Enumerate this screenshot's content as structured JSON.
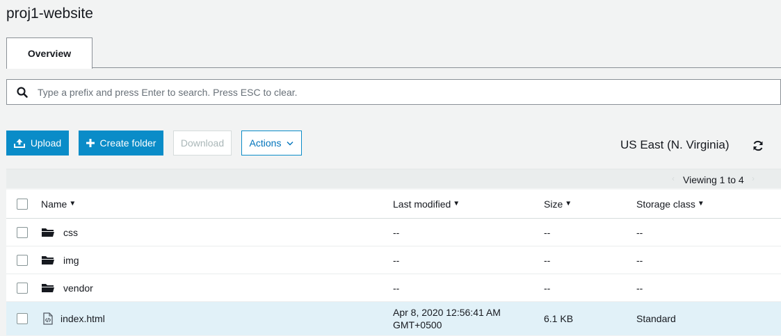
{
  "page": {
    "title": "proj1-website"
  },
  "tabs": [
    {
      "label": "Overview",
      "active": true
    }
  ],
  "search": {
    "placeholder": "Type a prefix and press Enter to search. Press ESC to clear.",
    "value": ""
  },
  "toolbar": {
    "upload_label": "Upload",
    "create_folder_label": "Create folder",
    "download_label": "Download",
    "actions_label": "Actions",
    "region": "US East (N. Virginia)"
  },
  "paging": {
    "label": "Viewing 1 to 4"
  },
  "table": {
    "columns": {
      "name": "Name",
      "last_modified": "Last modified",
      "size": "Size",
      "storage_class": "Storage class"
    },
    "rows": [
      {
        "type": "folder",
        "name": "css",
        "last_modified": "--",
        "last_modified_2": "",
        "size": "--",
        "storage_class": "--"
      },
      {
        "type": "folder",
        "name": "img",
        "last_modified": "--",
        "last_modified_2": "",
        "size": "--",
        "storage_class": "--"
      },
      {
        "type": "folder",
        "name": "vendor",
        "last_modified": "--",
        "last_modified_2": "",
        "size": "--",
        "storage_class": "--"
      },
      {
        "type": "file",
        "name": "index.html",
        "last_modified": "Apr 8, 2020 12:56:41 AM",
        "last_modified_2": "GMT+0500",
        "size": "6.1 KB",
        "storage_class": "Standard"
      }
    ]
  },
  "colors": {
    "primary": "#0a8cc8",
    "selected_row": "#e1f1f8",
    "background": "#f2f3f3"
  },
  "icons": {
    "search": "search-icon",
    "upload": "upload-icon",
    "plus": "plus-icon",
    "chevron": "chevron-down-icon",
    "refresh": "refresh-icon",
    "folder": "folder-icon",
    "file": "html-file-icon"
  }
}
